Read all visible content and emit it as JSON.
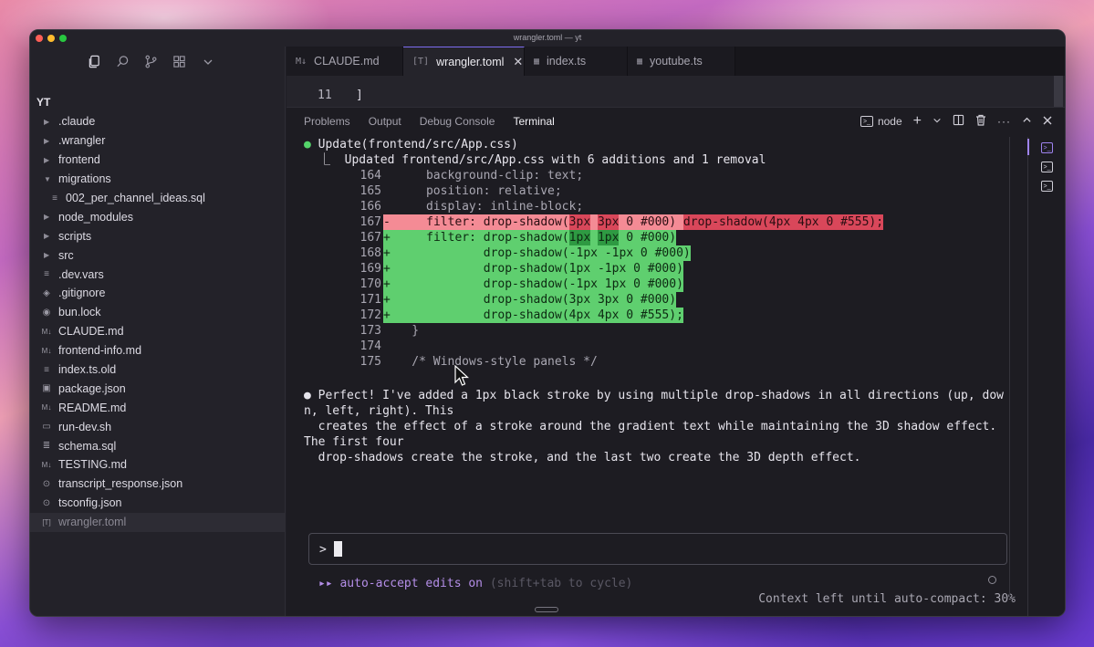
{
  "window": {
    "title": "wrangler.toml — yt"
  },
  "sidebar": {
    "toolbar": [
      "files-icon",
      "search-icon",
      "source-control-icon",
      "extensions-icon",
      "chevron-down-icon"
    ],
    "root": "YT",
    "items": [
      {
        "label": ".claude",
        "type": "folder",
        "icon": "chevron-right-icon"
      },
      {
        "label": ".wrangler",
        "type": "folder",
        "icon": "chevron-right-icon"
      },
      {
        "label": "frontend",
        "type": "folder",
        "icon": "chevron-right-icon"
      },
      {
        "label": "migrations",
        "type": "folder-open",
        "icon": "chevron-down-icon"
      },
      {
        "label": "002_per_channel_ideas.sql",
        "type": "file",
        "icon": "lines-icon"
      },
      {
        "label": "node_modules",
        "type": "folder",
        "icon": "chevron-right-icon"
      },
      {
        "label": "scripts",
        "type": "folder",
        "icon": "chevron-right-icon"
      },
      {
        "label": "src",
        "type": "folder",
        "icon": "chevron-right-icon"
      },
      {
        "label": ".dev.vars",
        "type": "file",
        "icon": "lines-icon"
      },
      {
        "label": ".gitignore",
        "type": "file",
        "icon": "git-icon"
      },
      {
        "label": "bun.lock",
        "type": "file",
        "icon": "bun-icon"
      },
      {
        "label": "CLAUDE.md",
        "type": "file",
        "icon": "markdown-icon"
      },
      {
        "label": "frontend-info.md",
        "type": "file",
        "icon": "markdown-icon"
      },
      {
        "label": "index.ts.old",
        "type": "file",
        "icon": "lines-icon"
      },
      {
        "label": "package.json",
        "type": "file",
        "icon": "package-icon"
      },
      {
        "label": "README.md",
        "type": "file",
        "icon": "markdown-icon"
      },
      {
        "label": "run-dev.sh",
        "type": "file",
        "icon": "terminal-icon"
      },
      {
        "label": "schema.sql",
        "type": "file",
        "icon": "database-icon"
      },
      {
        "label": "TESTING.md",
        "type": "file",
        "icon": "markdown-icon"
      },
      {
        "label": "transcript_response.json",
        "type": "file",
        "icon": "settings-icon"
      },
      {
        "label": "tsconfig.json",
        "type": "file",
        "icon": "settings-icon"
      },
      {
        "label": "wrangler.toml",
        "type": "file",
        "icon": "toml-icon",
        "selected": true
      }
    ]
  },
  "tabs": [
    {
      "label": "CLAUDE.md",
      "icon": "M↓",
      "active": false
    },
    {
      "label": "wrangler.toml",
      "icon": "[T]",
      "active": true,
      "close": "✕"
    },
    {
      "label": "index.ts",
      "icon": "▦",
      "active": false
    },
    {
      "label": "youtube.ts",
      "icon": "▦",
      "active": false
    }
  ],
  "editor": {
    "line_number": "11",
    "line_code": "]"
  },
  "panel": {
    "tabs": [
      "Problems",
      "Output",
      "Debug Console",
      "Terminal"
    ],
    "active_tab": "Terminal",
    "terminal_name": "node"
  },
  "terminal": {
    "update_title": "Update(frontend/src/App.css)",
    "update_summary": "⎿  Updated frontend/src/App.css with 6 additions and 1 removal",
    "context_lines_before": [
      {
        "n": "164",
        "code": "    background-clip: text;"
      },
      {
        "n": "165",
        "code": "    position: relative;"
      },
      {
        "n": "166",
        "code": "    display: inline-block;"
      }
    ],
    "deleted_line": {
      "n": "167",
      "sign": "-",
      "pre": "    filter: drop-shadow(",
      "hl1": "3px",
      "mid1": " ",
      "hl2": "3px",
      "post": " 0 #000) ",
      "hl3": "drop-shadow(4px 4px 0 #555);"
    },
    "added_first": {
      "n": "167",
      "sign": "+",
      "pre": "    filter: drop-shadow(",
      "hl1": "1px",
      "mid1": " ",
      "hl2": "1px",
      "post": " 0 #000)"
    },
    "added_lines": [
      {
        "n": "168",
        "code": "            drop-shadow(-1px -1px 0 #000)"
      },
      {
        "n": "169",
        "code": "            drop-shadow(1px -1px 0 #000)"
      },
      {
        "n": "170",
        "code": "            drop-shadow(-1px 1px 0 #000)"
      },
      {
        "n": "171",
        "code": "            drop-shadow(3px 3px 0 #000)"
      },
      {
        "n": "172",
        "code": "            drop-shadow(4px 4px 0 #555);"
      }
    ],
    "context_lines_after": [
      {
        "n": "173",
        "code": "  }"
      },
      {
        "n": "174",
        "code": ""
      },
      {
        "n": "175",
        "code": "  /* Windows-style panels */"
      }
    ],
    "message_lines": [
      "● Perfect! I've added a 1px black stroke by using multiple drop-shadows in all directions (up, dow",
      "n, left, right). This",
      "  creates the effect of a stroke around the gradient text while maintaining the 3D shadow effect.",
      "The first four",
      "  drop-shadows create the stroke, and the last two create the 3D depth effect."
    ],
    "prompt": ">",
    "auto_accept": "▸▸ auto-accept edits on",
    "auto_accept_hint": " (shift+tab to cycle)",
    "context_left": "Context left until auto-compact: 30%"
  },
  "colors": {
    "accent": "#7d6cf0",
    "diff_delete": "#f48b95",
    "diff_delete_highlight": "#d9475a",
    "diff_add": "#5fcf6f",
    "diff_add_highlight": "#2e9a42",
    "success_bullet": "#54d46a"
  }
}
